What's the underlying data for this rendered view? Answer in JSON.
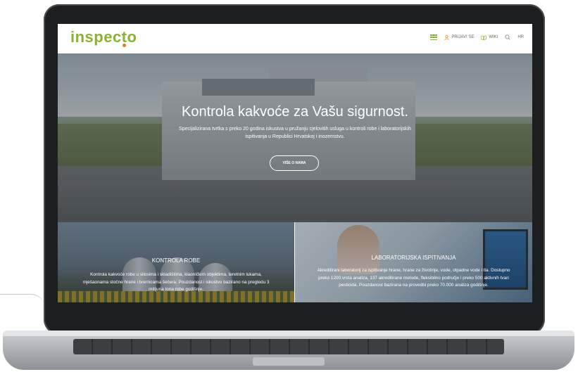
{
  "header": {
    "logo_text": "inspecto",
    "nav": {
      "login": "PRIJAVI SE",
      "wiki": "WIKI",
      "language": "HR"
    }
  },
  "hero": {
    "title": "Kontrola kakvoće za Vašu sigurnost.",
    "subtitle": "Specijalizirana tvrtka s preko 20 godina iskustva u pružanju cjelovitih usluga u kontroli robe i laboratorijskih ispitivanja u Republici Hrvatskoj i inozemstvu.",
    "button": "VIŠE O NAMA"
  },
  "cards": [
    {
      "title": "KONTROLA ROBE",
      "text": "Kontrola kakvoće robe u silosima i skladištima, klaoničkim objektima, teretnim lukama, mješaonama stočne hrane i tvornicama šećera. Pouzdanost i iskustvo bazirano na pregledu 3 milijuna tona robe godišnje."
    },
    {
      "title": "LABORATORIJSKA ISPITIVANJA",
      "text": "Akreditirani laboratorij za ispitivanje hrane, hrane za životinje, vode, otpadne vode i tla. Dostupno preko 1200 vrsta analiza, 137 akreditirane metode, fleksibilno područje i preko 500 aktivnih tvari pesticida. Pouzdanost bazirana na provedbi preko 70.000 analiza godišnje."
    }
  ],
  "colors": {
    "brand_green": "#8bb22e",
    "brand_orange": "#e07b1f"
  }
}
